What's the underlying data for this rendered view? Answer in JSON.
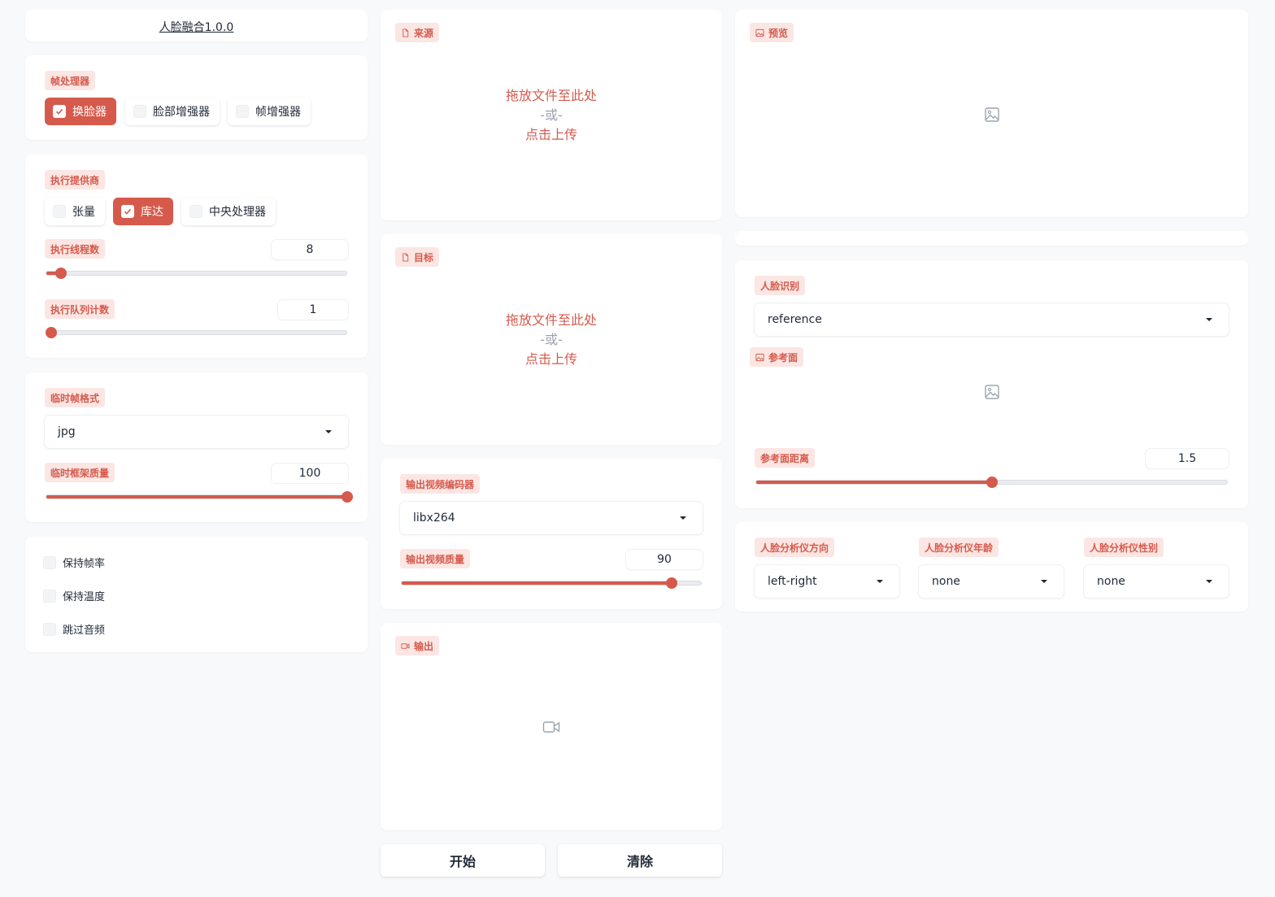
{
  "app": {
    "title": "人脸融合1.0.0"
  },
  "frame_processors": {
    "label": "帧处理器",
    "options": [
      {
        "label": "换脸器",
        "checked": true
      },
      {
        "label": "脸部增强器",
        "checked": false
      },
      {
        "label": "帧增强器",
        "checked": false
      }
    ]
  },
  "execution": {
    "providers_label": "执行提供商",
    "providers": [
      {
        "label": "张量",
        "checked": false
      },
      {
        "label": "库达",
        "checked": true
      },
      {
        "label": "中央处理器",
        "checked": false
      }
    ],
    "threads_label": "执行线程数",
    "threads_value": "8",
    "threads_fraction": 0.05,
    "queue_label": "执行队列计数",
    "queue_value": "1",
    "queue_fraction": 0.0
  },
  "temp": {
    "format_label": "临时帧格式",
    "format_value": "jpg",
    "quality_label": "临时框架质量",
    "quality_value": "100",
    "quality_fraction": 1.0
  },
  "misc": {
    "options": [
      {
        "label": "保持帧率"
      },
      {
        "label": "保持温度"
      },
      {
        "label": "跳过音频"
      }
    ]
  },
  "source": {
    "label": "来源",
    "drop_text": "拖放文件至此处",
    "or_text": "-或-",
    "click_text": "点击上传"
  },
  "target": {
    "label": "目标",
    "drop_text": "拖放文件至此处",
    "or_text": "-或-",
    "click_text": "点击上传"
  },
  "output_video": {
    "encoder_label": "输出视频编码器",
    "encoder_value": "libx264",
    "quality_label": "输出视频质量",
    "quality_value": "90",
    "quality_fraction": 0.9
  },
  "output": {
    "label": "输出"
  },
  "actions": {
    "start": "开始",
    "clear": "清除"
  },
  "preview": {
    "label": "预览"
  },
  "face_recognition": {
    "label": "人脸识别",
    "value": "reference",
    "reference_label": "参考面",
    "distance_label": "参考面距离",
    "distance_value": "1.5",
    "distance_fraction": 0.5
  },
  "analyser": {
    "direction_label": "人脸分析仪方向",
    "direction_value": "left-right",
    "age_label": "人脸分析仪年龄",
    "age_value": "none",
    "gender_label": "人脸分析仪性别",
    "gender_value": "none"
  },
  "colors": {
    "accent": "#d55a4c",
    "accent_light": "#fbe6e3",
    "background": "#f8f9fb"
  },
  "icons": {
    "file": "file-icon",
    "image": "image-icon",
    "video": "video-icon",
    "check": "check-icon",
    "caret": "chevron-down-icon"
  }
}
